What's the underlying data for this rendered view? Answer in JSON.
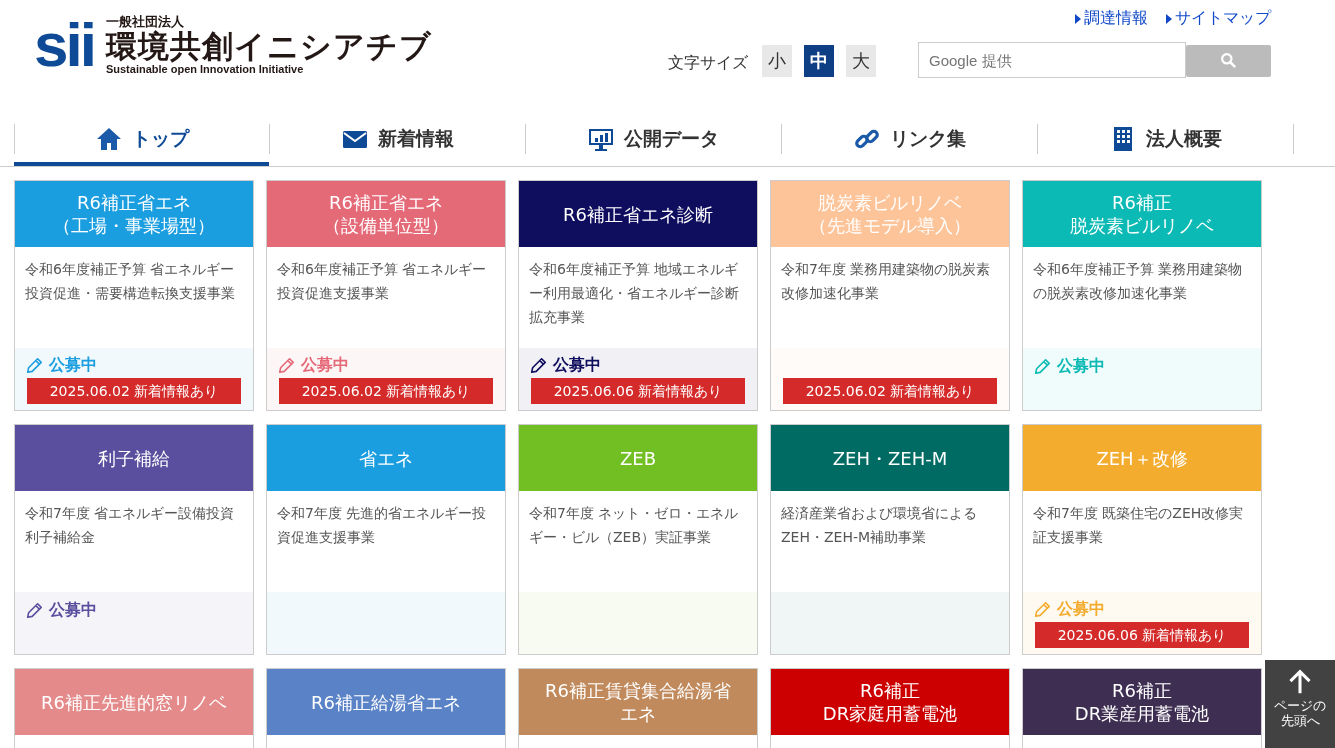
{
  "header": {
    "logo_mark": "sii",
    "org_type": "一般社団法人",
    "org_name": "環境共創イニシアチブ",
    "org_english": "Sustainable open Innovation Initiative",
    "top_links": [
      "調達情報",
      "サイトマップ"
    ],
    "font_size": {
      "label": "文字サイズ",
      "options": [
        {
          "label": "小",
          "selected": false
        },
        {
          "label": "中",
          "selected": true
        },
        {
          "label": "大",
          "selected": false
        }
      ]
    },
    "search": {
      "placeholder": "Google 提供"
    }
  },
  "nav": [
    {
      "label": "トップ",
      "kind": "home",
      "selected": true
    },
    {
      "label": "新着情報",
      "kind": "mail",
      "selected": false
    },
    {
      "label": "公開データ",
      "kind": "monitor",
      "selected": false
    },
    {
      "label": "リンク集",
      "kind": "link",
      "selected": false
    },
    {
      "label": "法人概要",
      "kind": "building",
      "selected": false
    }
  ],
  "cards": [
    {
      "title": [
        "R6補正省エネ",
        "（工場・事業場型）"
      ],
      "color": "#1b9ee0",
      "description": "令和6年度補正予算 省エネルギー投資促進・需要構造転換支援事業",
      "status": "公募中",
      "notice": "2025.06.02 新着情報あり"
    },
    {
      "title": [
        "R6補正省エネ",
        "（設備単位型）"
      ],
      "color": "#e56a78",
      "description": "令和6年度補正予算 省エネルギー投資促進支援事業",
      "status": "公募中",
      "notice": "2025.06.02 新着情報あり"
    },
    {
      "title": [
        "R6補正省エネ診断"
      ],
      "color": "#0f0d5e",
      "description": "令和6年度補正予算 地域エネルギー利用最適化・省エネルギー診断拡充事業",
      "status": "公募中",
      "notice": "2025.06.06 新着情報あり"
    },
    {
      "title": [
        "脱炭素ビルリノベ",
        "（先進モデル導入）"
      ],
      "color": "#fdc49a",
      "description": "令和7年度 業務用建築物の脱炭素改修加速化事業",
      "notice": "2025.06.02 新着情報あり"
    },
    {
      "title": [
        "R6補正",
        "脱炭素ビルリノベ"
      ],
      "color": "#0bbab4",
      "description": "令和6年度補正予算 業務用建築物の脱炭素改修加速化事業",
      "status": "公募中"
    },
    {
      "title": [
        "利子補給"
      ],
      "color": "#5a4f9e",
      "description": "令和7年度 省エネルギー設備投資利子補給金",
      "status": "公募中"
    },
    {
      "title": [
        "省エネ"
      ],
      "color": "#1b9ee0",
      "description": "令和7年度 先進的省エネルギー投資促進支援事業"
    },
    {
      "title": [
        "ZEB"
      ],
      "color": "#72bf23",
      "description": "令和7年度 ネット・ゼロ・エネルギー・ビル（ZEB）実証事業"
    },
    {
      "title": [
        "ZEH・ZEH-M"
      ],
      "color": "#006b63",
      "description": "経済産業省および環境省によるZEH・ZEH-M補助事業"
    },
    {
      "title": [
        "ZEH＋改修"
      ],
      "color": "#f3ac2e",
      "description": "令和7年度 既築住宅のZEH改修実証支援事業",
      "status": "公募中",
      "notice": "2025.06.06 新着情報あり"
    },
    {
      "title": [
        "R6補正先進的窓リノベ"
      ],
      "color": "#e48a8a"
    },
    {
      "title": [
        "R6補正給湯省エネ"
      ],
      "color": "#5a82c6"
    },
    {
      "title": [
        "R6補正賃貸集合給湯省",
        "エネ"
      ],
      "color": "#c08a5c"
    },
    {
      "title": [
        "R6補正",
        "DR家庭用蓄電池"
      ],
      "color": "#cc0000"
    },
    {
      "title": [
        "R6補正",
        "DR業産用蓄電池"
      ],
      "color": "#3d2e52"
    }
  ],
  "page_top": {
    "label": [
      "ページの",
      "先頭へ"
    ]
  }
}
